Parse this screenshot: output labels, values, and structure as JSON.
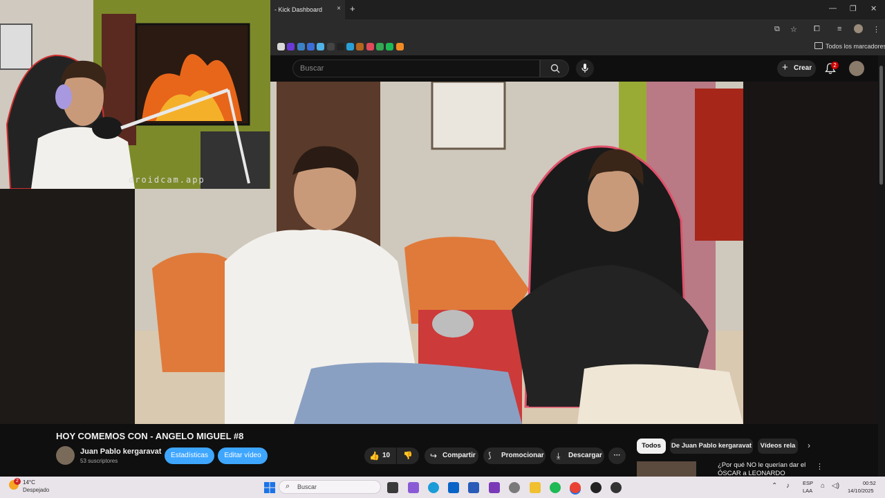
{
  "browser": {
    "tab_title": "- Kick Dashboard",
    "tab_close": "×",
    "new_tab": "+",
    "window_controls": [
      "—",
      "❐",
      "✕"
    ],
    "bookmarks_label": "Todos los marcadores",
    "bookmark_colors": [
      "#d9d9d9",
      "#6a3ad6",
      "#3b82c4",
      "#3b6dd8",
      "#4fb3e8",
      "#444444",
      "#222222",
      "#2a9fd6",
      "#b5651d",
      "#e04a5a",
      "#34a853",
      "#1db954",
      "#f28b22"
    ]
  },
  "youtube": {
    "search_placeholder": "Buscar",
    "create_label": "Crear",
    "notification_count": "2"
  },
  "webcam": {
    "watermark": "droidcam.app"
  },
  "video": {
    "title": "HOY COMEMOS CON - ANGELO MIGUEL #8",
    "channel_name": "Juan Pablo kergaravat",
    "subscribers": "53 suscriptores",
    "stats_button": "Estadísticas",
    "edit_button": "Editar vídeo",
    "likes": "10",
    "share": "Compartir",
    "promote": "Promocionar",
    "download": "Descargar",
    "more": "···"
  },
  "chips": [
    "Todos",
    "De Juan Pablo kergaravat",
    "Vídeos rela"
  ],
  "recommendation": {
    "title": "¿Por qué NO le querían dar el ÓSCAR a LEONARDO"
  },
  "taskbar": {
    "temperature": "14°C",
    "weather": "Despejado",
    "weather_badge": "2",
    "search_label": "Buscar",
    "lang_line1": "ESP",
    "lang_line2": "LAA",
    "time": "00:52",
    "date": "14/10/2025"
  },
  "colors": {
    "accent_blue": "#3ea6ff",
    "notification_red": "#cc0000"
  }
}
